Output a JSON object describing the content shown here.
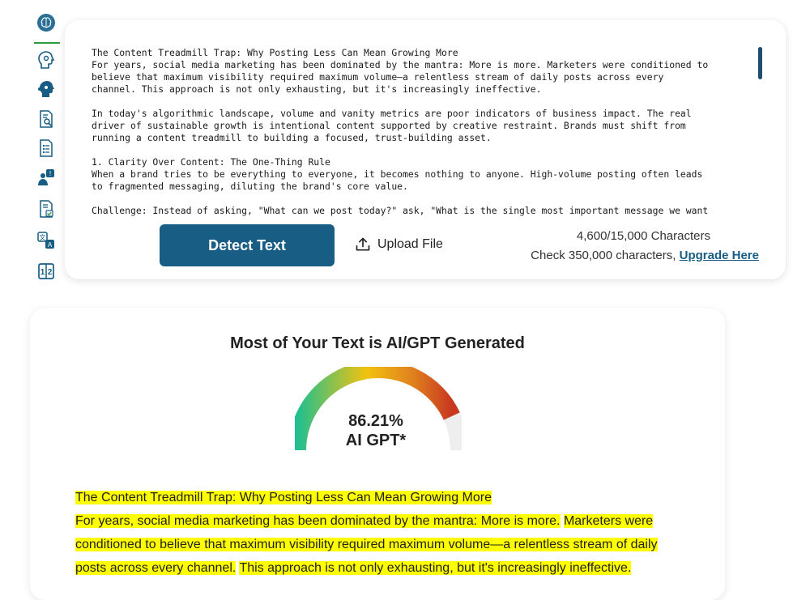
{
  "sidebar": {
    "items": [
      {
        "name": "brain-icon"
      },
      {
        "name": "head-profile-icon"
      },
      {
        "name": "robot-head-icon"
      },
      {
        "name": "document-search-icon"
      },
      {
        "name": "document-list-icon"
      },
      {
        "name": "question-person-icon"
      },
      {
        "name": "document-check-icon"
      },
      {
        "name": "translate-icon"
      },
      {
        "name": "calculator-icon"
      }
    ]
  },
  "input": {
    "text": "The Content Treadmill Trap: Why Posting Less Can Mean Growing More\nFor years, social media marketing has been dominated by the mantra: More is more. Marketers were conditioned to\nbelieve that maximum visibility required maximum volume—a relentless stream of daily posts across every\nchannel. This approach is not only exhausting, but it's increasingly ineffective.\n\nIn today's algorithmic landscape, volume and vanity metrics are poor indicators of business impact. The real\ndriver of sustainable growth is intentional content supported by creative restraint. Brands must shift from\nrunning a content treadmill to building a focused, trust-building asset.\n\n1. Clarity Over Content: The One-Thing Rule\nWhen a brand tries to be everything to everyone, it becomes nothing to anyone. High-volume posting often leads\nto fragmented messaging, diluting the brand's core value.\n\nChallenge: Instead of asking, \"What can we post today?\" ask, \"What is the single most important message we want",
    "detect_label": "Detect Text",
    "upload_label": "Upload File",
    "char_count": "4,600/15,000 Characters",
    "check_text": "Check 350,000 characters,",
    "upgrade_label": "Upgrade Here"
  },
  "result": {
    "title": "Most of Your Text is AI/GPT Generated",
    "percent": "86.21%",
    "percent_value": 86.21,
    "label": "AI GPT*",
    "paragraph_lines": [
      "The Content Treadmill Trap: Why Posting Less Can Mean Growing More",
      "For years, social media marketing has been dominated by the mantra: More is more.",
      "Marketers were",
      "conditioned to believe that maximum visibility required maximum volume—a relentless stream of daily",
      "posts across every channel.",
      "This approach is not only exhausting, but it's increasingly ineffective."
    ]
  },
  "colors": {
    "accent": "#175d84",
    "highlight": "#ffff00",
    "active_indicator": "#2c9a3e"
  }
}
